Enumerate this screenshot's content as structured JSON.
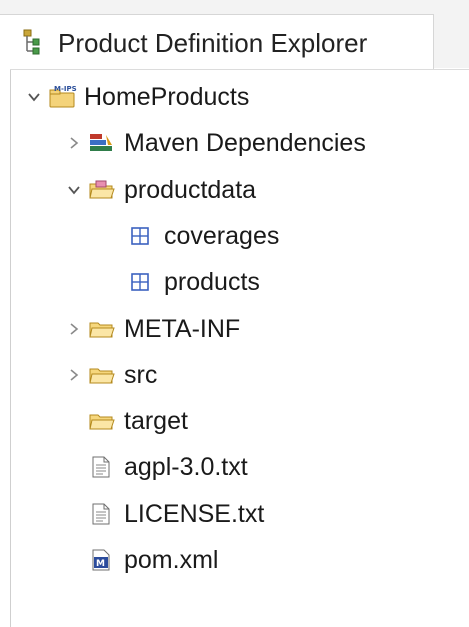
{
  "view": {
    "title": "Product Definition Explorer",
    "icon": "hierarchy-icon"
  },
  "tree": [
    {
      "label": "HomeProducts",
      "icon": "ips-project-icon",
      "expander": "expanded",
      "level": 0
    },
    {
      "label": "Maven Dependencies",
      "icon": "library-icon",
      "expander": "collapsed",
      "level": 1
    },
    {
      "label": "productdata",
      "icon": "package-folder-open-icon",
      "expander": "expanded",
      "level": 1
    },
    {
      "label": "coverages",
      "icon": "table-grid-icon",
      "expander": "none",
      "level": 2
    },
    {
      "label": "products",
      "icon": "table-grid-icon",
      "expander": "none",
      "level": 2
    },
    {
      "label": "META-INF",
      "icon": "folder-icon",
      "expander": "collapsed",
      "level": 1
    },
    {
      "label": "src",
      "icon": "folder-icon",
      "expander": "collapsed",
      "level": 1
    },
    {
      "label": "target",
      "icon": "folder-icon",
      "expander": "none",
      "level": 1
    },
    {
      "label": "agpl-3.0.txt",
      "icon": "text-file-icon",
      "expander": "none",
      "level": 1
    },
    {
      "label": "LICENSE.txt",
      "icon": "text-file-icon",
      "expander": "none",
      "level": 1
    },
    {
      "label": "pom.xml",
      "icon": "maven-file-icon",
      "expander": "none",
      "level": 1
    }
  ]
}
